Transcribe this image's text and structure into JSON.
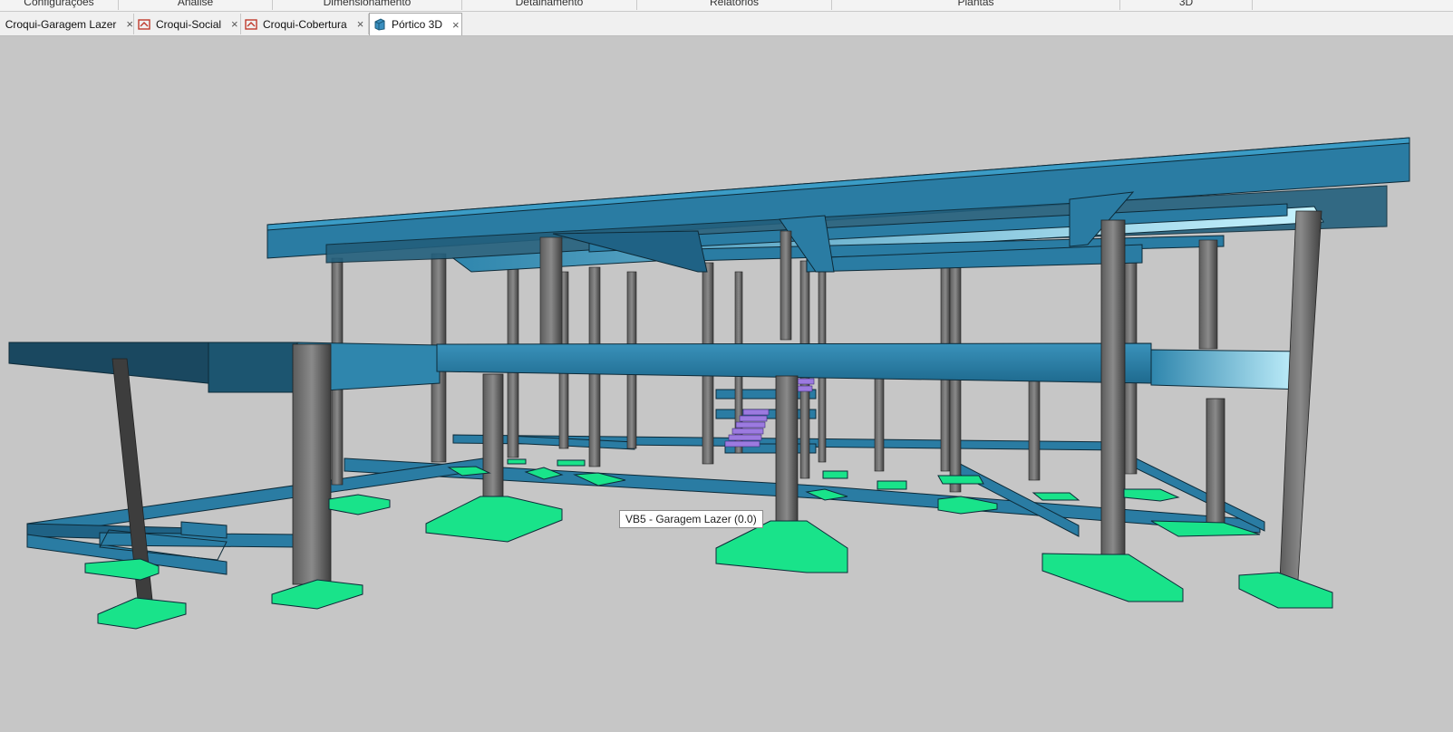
{
  "menu": {
    "items": [
      "Configurações",
      "Análise",
      "Dimensionamento",
      "Detalhamento",
      "Relatórios",
      "Plantas",
      "3D"
    ]
  },
  "tabs": [
    {
      "label": "Croqui-Garagem Lazer",
      "icon": "croqui-icon",
      "active": false
    },
    {
      "label": "Croqui-Social",
      "icon": "croqui-icon",
      "active": false
    },
    {
      "label": "Croqui-Cobertura",
      "icon": "croqui-icon",
      "active": false
    },
    {
      "label": "Pórtico 3D",
      "icon": "portico-3d-icon",
      "active": true
    }
  ],
  "close_glyph": "×",
  "viewport": {
    "tooltip": "VB5 - Garagem Lazer (0.0)"
  },
  "colors": {
    "background": "#c6c6c6",
    "beam": "#2a7a9e",
    "beam_dark": "#1c5a78",
    "slab_light": "#bfeeff",
    "column": "#6e6e6e",
    "footing": "#19e38a",
    "stair": "#9c7ae0"
  }
}
